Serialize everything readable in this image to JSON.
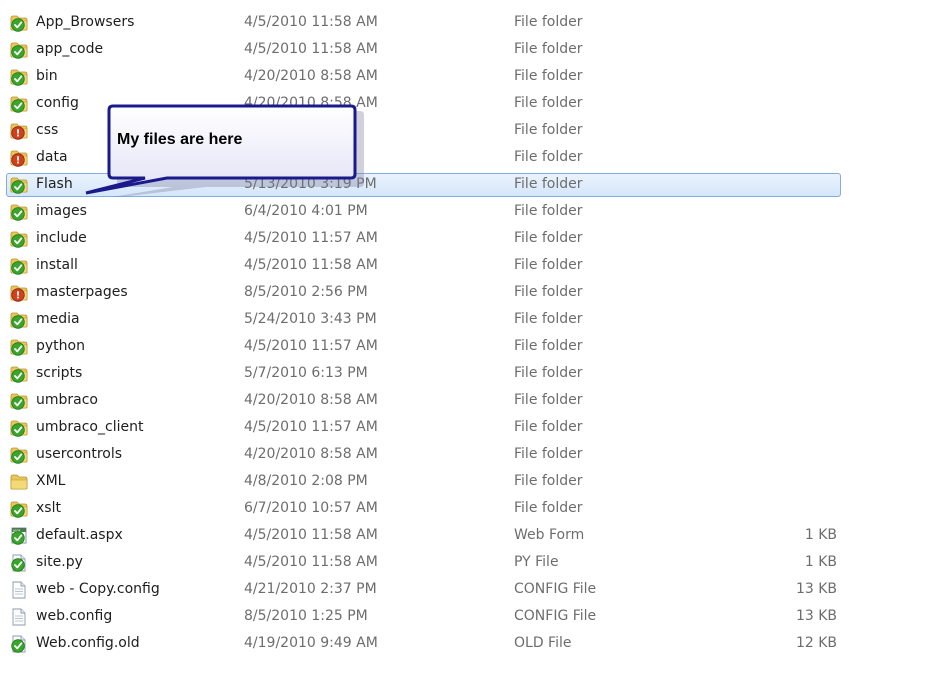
{
  "callout": {
    "text": "My files are here"
  },
  "files": [
    {
      "name": "App_Browsers",
      "date": "4/5/2010 11:58 AM",
      "type": "File folder",
      "size": "",
      "icon": "folder-check-icon"
    },
    {
      "name": "app_code",
      "date": "4/5/2010 11:58 AM",
      "type": "File folder",
      "size": "",
      "icon": "folder-check-icon"
    },
    {
      "name": "bin",
      "date": "4/20/2010 8:58 AM",
      "type": "File folder",
      "size": "",
      "icon": "folder-check-icon"
    },
    {
      "name": "config",
      "date": "4/20/2010 8:58 AM",
      "type": "File folder",
      "size": "",
      "icon": "folder-check-icon"
    },
    {
      "name": "css",
      "date": "",
      "type": "File folder",
      "size": "",
      "icon": "folder-conflict-icon"
    },
    {
      "name": "data",
      "date": "",
      "type": "File folder",
      "size": "",
      "icon": "folder-conflict-icon"
    },
    {
      "name": "Flash",
      "date": "5/13/2010 3:19 PM",
      "type": "File folder",
      "size": "",
      "icon": "folder-check-icon",
      "selected": true
    },
    {
      "name": "images",
      "date": "6/4/2010 4:01 PM",
      "type": "File folder",
      "size": "",
      "icon": "folder-check-icon"
    },
    {
      "name": "include",
      "date": "4/5/2010 11:57 AM",
      "type": "File folder",
      "size": "",
      "icon": "folder-check-icon"
    },
    {
      "name": "install",
      "date": "4/5/2010 11:58 AM",
      "type": "File folder",
      "size": "",
      "icon": "folder-check-icon"
    },
    {
      "name": "masterpages",
      "date": "8/5/2010 2:56 PM",
      "type": "File folder",
      "size": "",
      "icon": "folder-conflict-icon"
    },
    {
      "name": "media",
      "date": "5/24/2010 3:43 PM",
      "type": "File folder",
      "size": "",
      "icon": "folder-check-icon"
    },
    {
      "name": "python",
      "date": "4/5/2010 11:57 AM",
      "type": "File folder",
      "size": "",
      "icon": "folder-check-icon"
    },
    {
      "name": "scripts",
      "date": "5/7/2010 6:13 PM",
      "type": "File folder",
      "size": "",
      "icon": "folder-check-icon"
    },
    {
      "name": "umbraco",
      "date": "4/20/2010 8:58 AM",
      "type": "File folder",
      "size": "",
      "icon": "folder-check-icon"
    },
    {
      "name": "umbraco_client",
      "date": "4/5/2010 11:57 AM",
      "type": "File folder",
      "size": "",
      "icon": "folder-check-icon"
    },
    {
      "name": "usercontrols",
      "date": "4/20/2010 8:58 AM",
      "type": "File folder",
      "size": "",
      "icon": "folder-check-icon"
    },
    {
      "name": "XML",
      "date": "4/8/2010 2:08 PM",
      "type": "File folder",
      "size": "",
      "icon": "folder-icon"
    },
    {
      "name": "xslt",
      "date": "6/7/2010 10:57 AM",
      "type": "File folder",
      "size": "",
      "icon": "folder-check-icon"
    },
    {
      "name": "default.aspx",
      "date": "4/5/2010 11:58 AM",
      "type": "Web Form",
      "size": "1 KB",
      "icon": "aspx-file-check-icon"
    },
    {
      "name": "site.py",
      "date": "4/5/2010 11:58 AM",
      "type": "PY File",
      "size": "1 KB",
      "icon": "file-check-icon"
    },
    {
      "name": "web - Copy.config",
      "date": "4/21/2010 2:37 PM",
      "type": "CONFIG File",
      "size": "13 KB",
      "icon": "document-icon"
    },
    {
      "name": "web.config",
      "date": "8/5/2010 1:25 PM",
      "type": "CONFIG File",
      "size": "13 KB",
      "icon": "document-icon"
    },
    {
      "name": "Web.config.old",
      "date": "4/19/2010 9:49 AM",
      "type": "OLD File",
      "size": "12 KB",
      "icon": "file-check-icon"
    }
  ],
  "colors": {
    "selection_border": "#84acdd",
    "selection_fill": "#d5e6fa",
    "callout_border": "#1a1a8c",
    "status_ok": "#3aa52c",
    "status_conflict": "#d0401c",
    "folder": "#e8c65a"
  }
}
